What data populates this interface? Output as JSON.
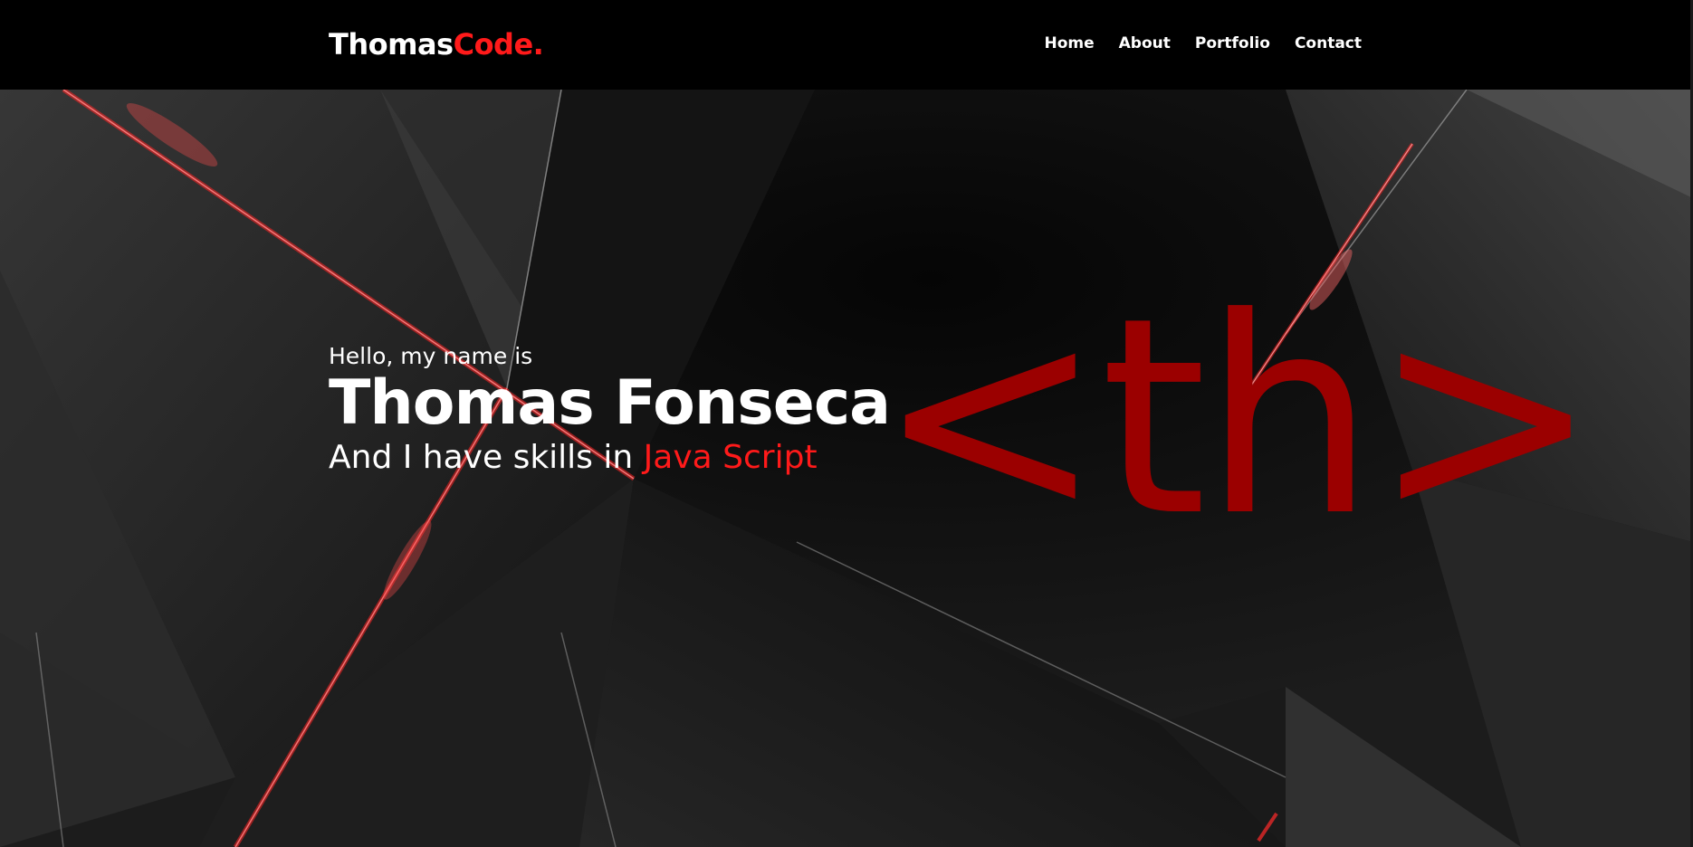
{
  "brand": {
    "name": "Thomas",
    "accent": "Code."
  },
  "nav": {
    "items": [
      {
        "label": "Home"
      },
      {
        "label": "About"
      },
      {
        "label": "Portfolio"
      },
      {
        "label": "Contact"
      }
    ]
  },
  "hero": {
    "greeting": "Hello, my name is",
    "name": "Thomas Fonseca",
    "skills_prefix": "And I have skills in",
    "skills_highlight": "Java Script",
    "logo_mark": "<th>"
  },
  "colors": {
    "background": "#000000",
    "accent": "#ff1a1a",
    "logo_red": "#9b0000",
    "text": "#ffffff"
  }
}
